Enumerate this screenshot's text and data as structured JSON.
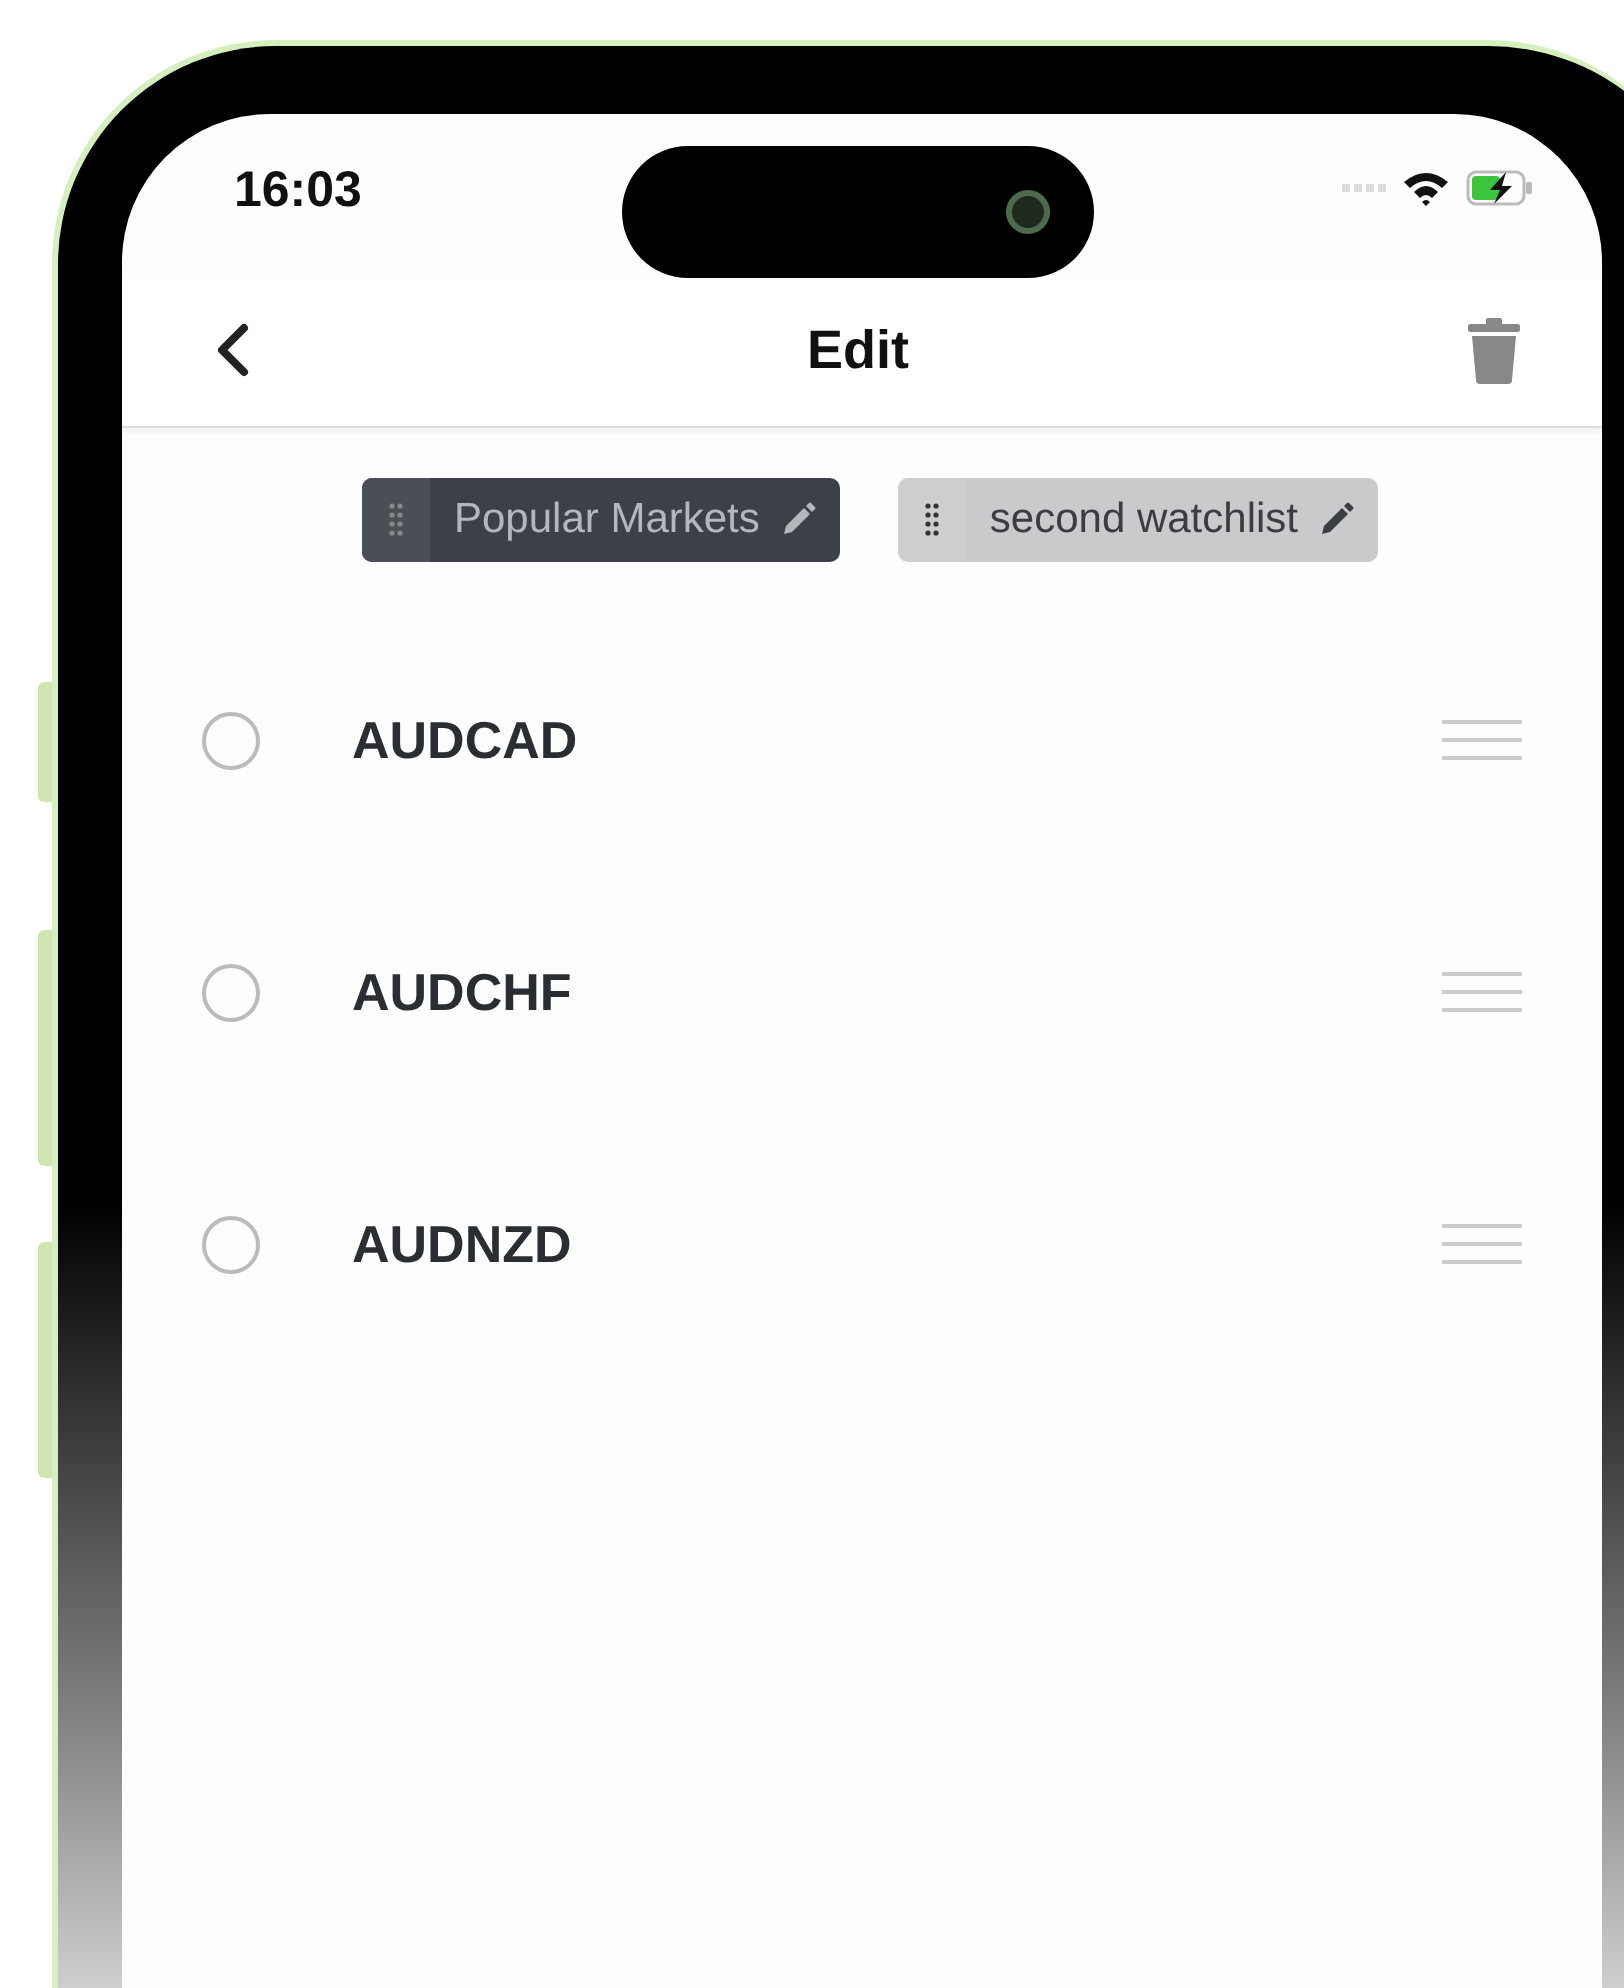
{
  "status_bar": {
    "time": "16:03"
  },
  "nav": {
    "title": "Edit"
  },
  "watchlist_tabs": [
    {
      "label": "Popular Markets",
      "selected": true
    },
    {
      "label": "second watchlist",
      "selected": false
    }
  ],
  "items": [
    {
      "symbol": "AUDCAD",
      "selected": false
    },
    {
      "symbol": "AUDCHF",
      "selected": false
    },
    {
      "symbol": "AUDNZD",
      "selected": false
    }
  ]
}
